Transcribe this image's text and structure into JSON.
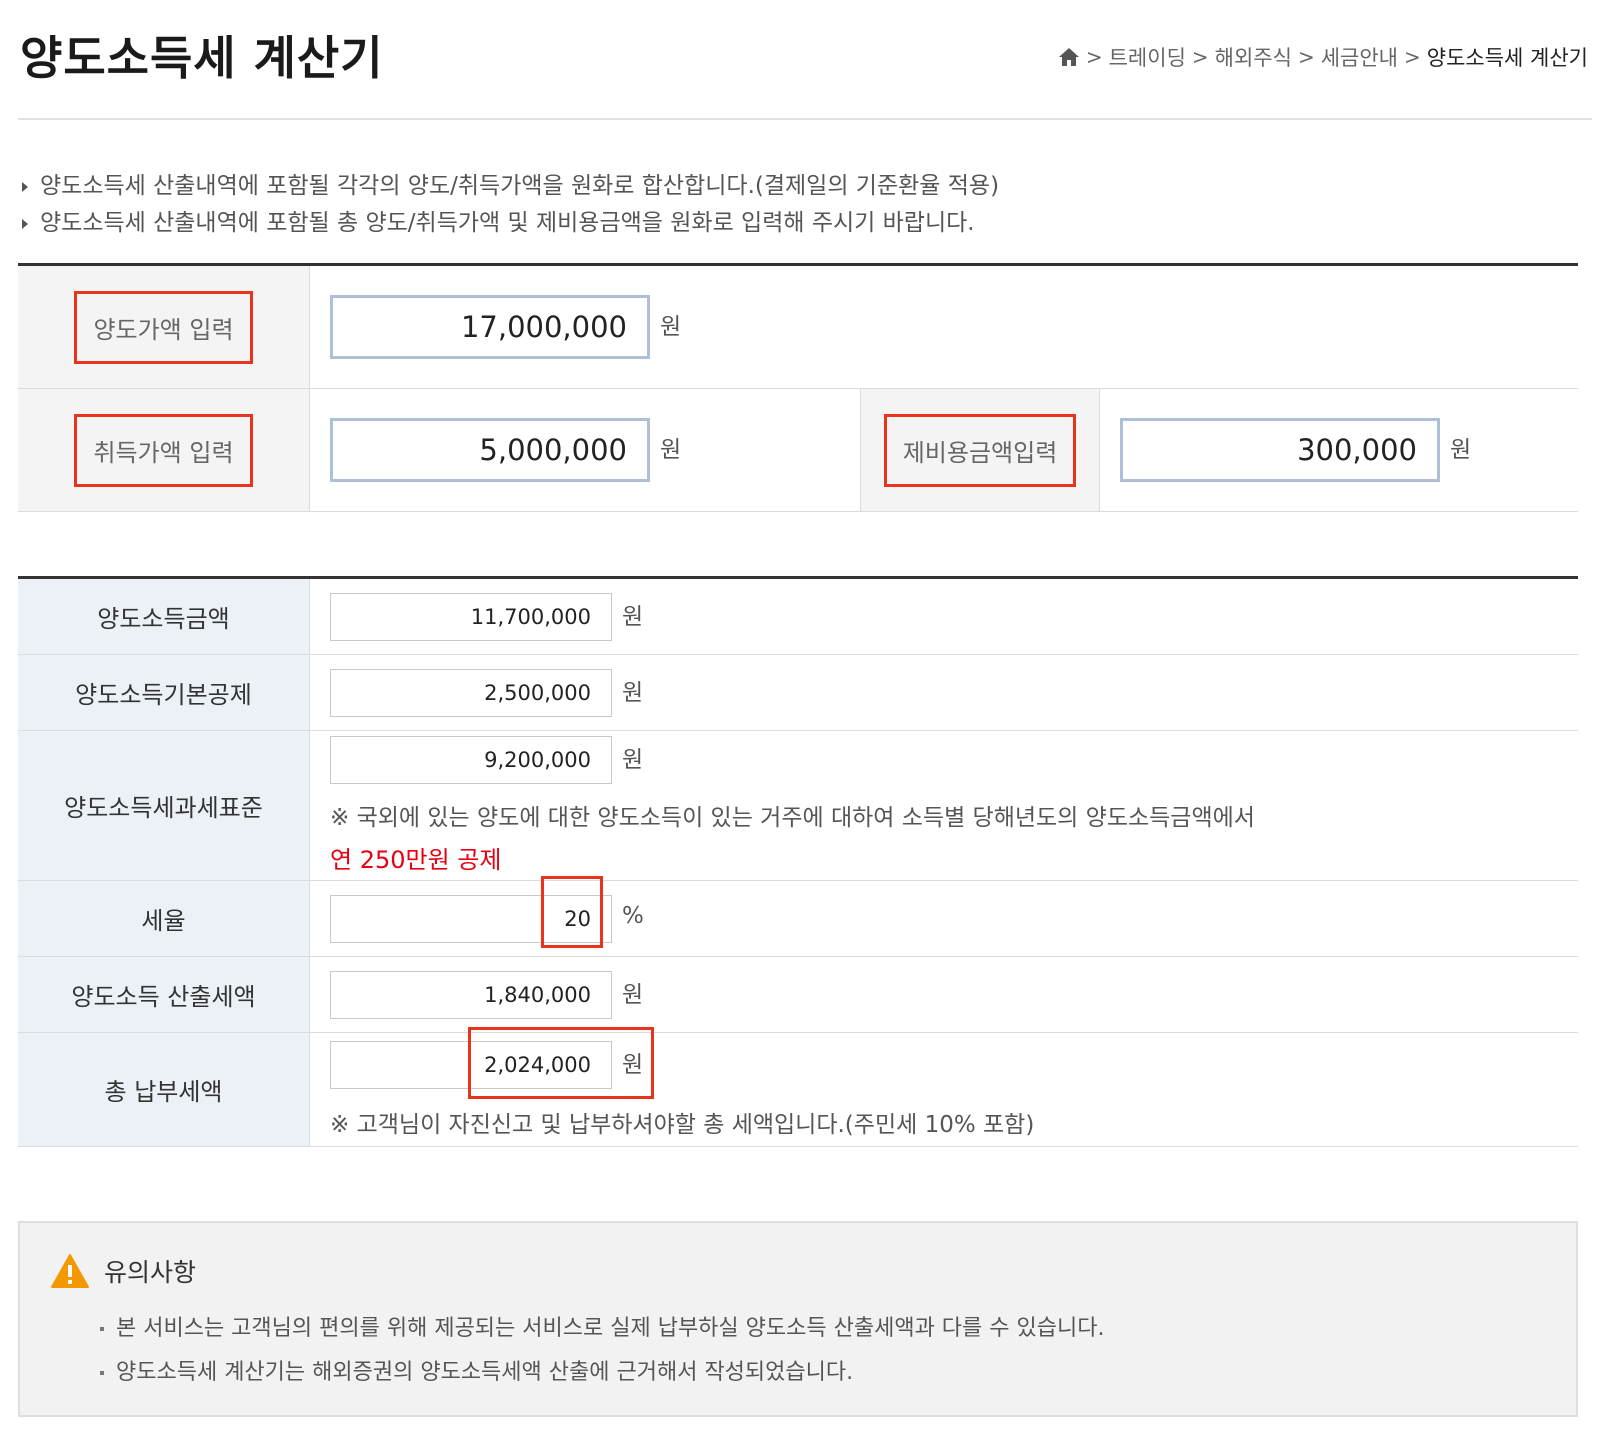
{
  "header": {
    "title": "양도소득세 계산기",
    "breadcrumb": [
      "트레이딩",
      "해외주식",
      "세금안내",
      "양도소득세 계산기"
    ]
  },
  "notes": [
    "양도소득세 산출내역에 포함될 각각의 양도/취득가액을 원화로 합산합니다.(결제일의 기준환율 적용)",
    "양도소득세 산출내역에 포함될 총 양도/취득가액 및 제비용금액을 원화로 입력해 주시기 바랍니다."
  ],
  "inputs": {
    "sale_label": "양도가액 입력",
    "sale_value": "17,000,000",
    "acq_label": "취득가액 입력",
    "acq_value": "5,000,000",
    "expense_label": "제비용금액입력",
    "expense_value": "300,000",
    "unit": "원"
  },
  "results": {
    "income_label": "양도소득금액",
    "income_value": "11,700,000",
    "deduction_label": "양도소득기본공제",
    "deduction_value": "2,500,000",
    "taxbase_label": "양도소득세과세표준",
    "taxbase_value": "9,200,000",
    "taxbase_note": "※ 국외에 있는 양도에 대한 양도소득이 있는 거주에 대하여 소득별 당해년도의 양도소득금액에서",
    "taxbase_note_red": "연 250만원 공제",
    "rate_label": "세율",
    "rate_value": "20",
    "rate_unit": "%",
    "calc_label": "양도소득 산출세액",
    "calc_value": "1,840,000",
    "total_label": "총 납부세액",
    "total_value": "2,024,000",
    "total_note": "※ 고객님이 자진신고 및 납부하셔야할 총 세액입니다.(주민세 10% 포함)",
    "unit": "원"
  },
  "caution": {
    "title": "유의사항",
    "items": [
      "본 서비스는 고객님의 편의를 위해 제공되는 서비스로 실제 납부하실 양도소득 산출세액과 다를 수 있습니다.",
      "양도소득세 계산기는 해외증권의 양도소득세액 산출에 근거해서 작성되었습니다."
    ]
  },
  "colors": {
    "highlight": "#e8341c",
    "input_border": "#aebfd8",
    "label_bg_result": "#ebf1f7",
    "warning_orange": "#f39800",
    "red_text": "#e60012"
  }
}
